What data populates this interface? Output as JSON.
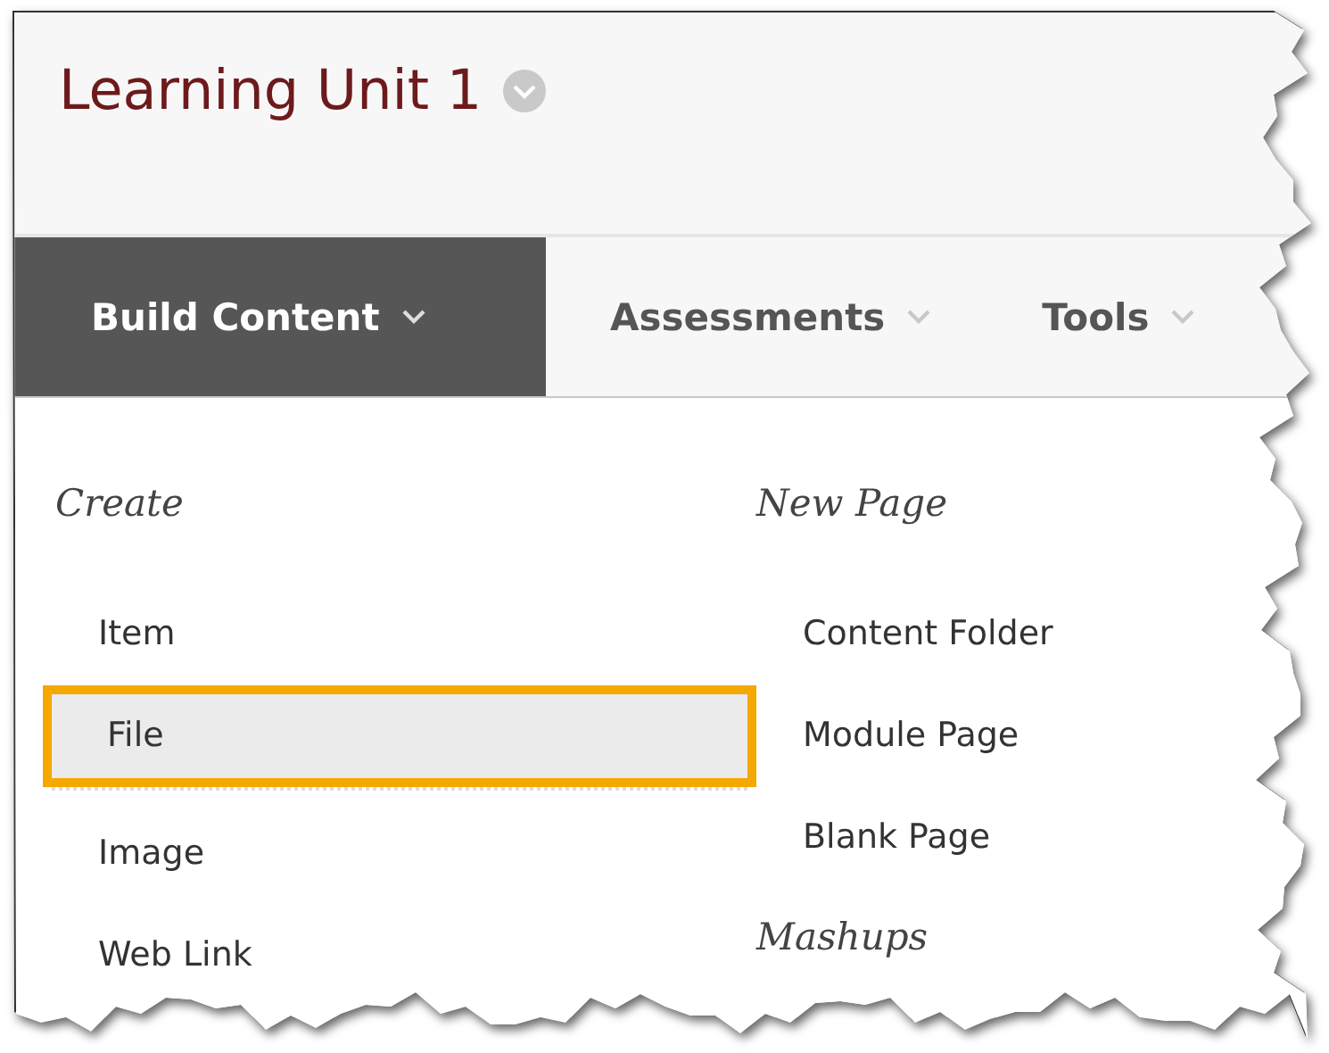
{
  "page_title": {
    "text": "Learning Unit 1"
  },
  "tabs": [
    {
      "label": "Build Content",
      "selected": true
    },
    {
      "label": "Assessments",
      "selected": false
    },
    {
      "label": "Tools",
      "selected": false
    }
  ],
  "menu": {
    "columns": [
      {
        "sections": [
          {
            "heading": "Create",
            "items": [
              {
                "label": "Item",
                "selected": false
              },
              {
                "label": "File",
                "selected": true
              },
              {
                "label": "Image",
                "selected": false
              },
              {
                "label": "Web Link",
                "selected": false
              }
            ]
          }
        ]
      },
      {
        "sections": [
          {
            "heading": "New Page",
            "items": [
              {
                "label": "Content Folder",
                "selected": false
              },
              {
                "label": "Module Page",
                "selected": false
              },
              {
                "label": "Blank Page",
                "selected": false
              }
            ]
          },
          {
            "heading": "Mashups"
          }
        ]
      }
    ]
  }
}
